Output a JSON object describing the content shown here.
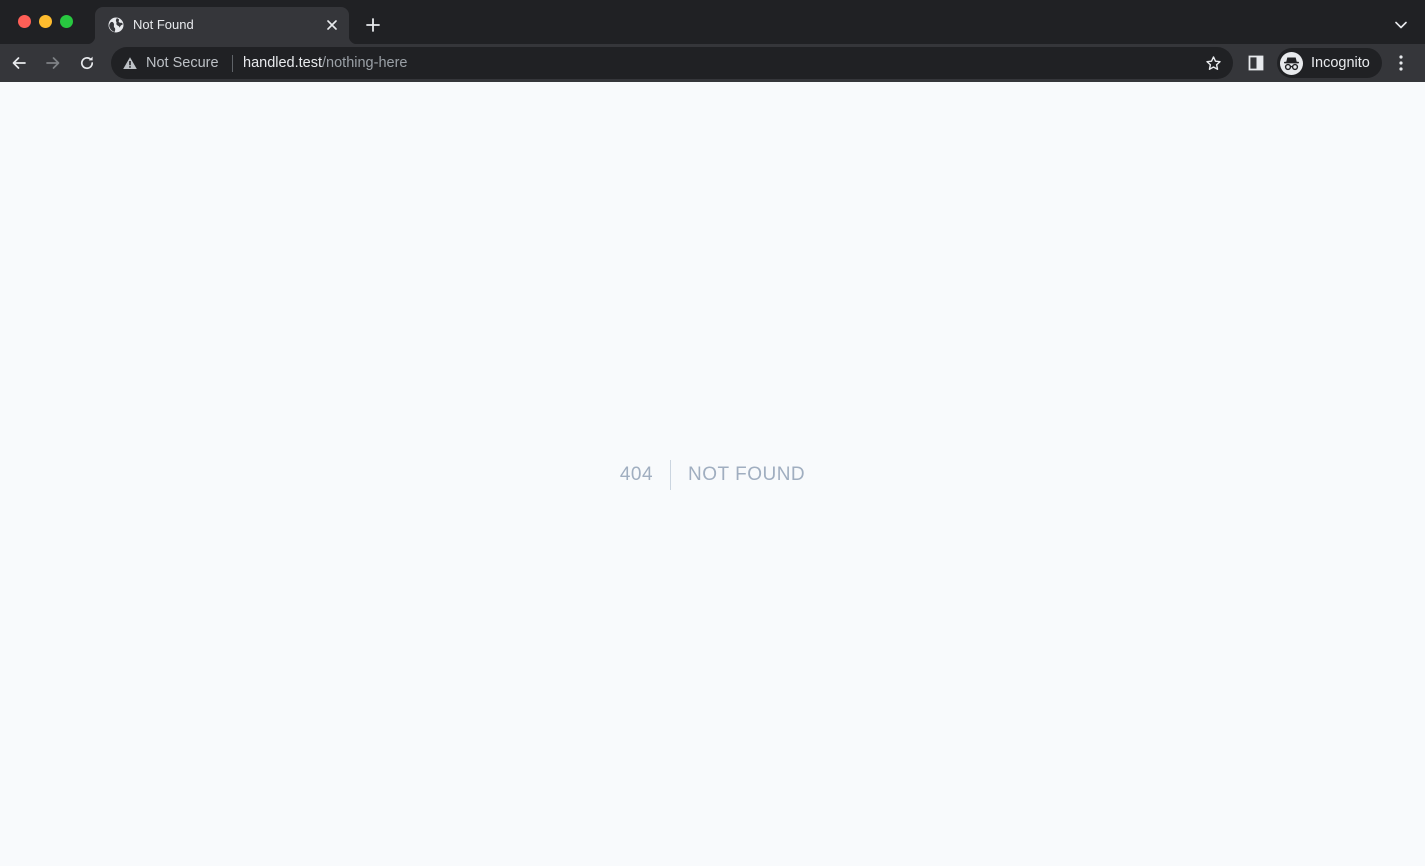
{
  "browser": {
    "tab": {
      "title": "Not Found",
      "favicon": "globe-icon"
    },
    "address_bar": {
      "security_label": "Not Secure",
      "url_host": "handled.test",
      "url_path": "/nothing-here"
    },
    "profile": {
      "label": "Incognito"
    }
  },
  "page": {
    "error_code": "404",
    "error_message": "NOT FOUND"
  }
}
